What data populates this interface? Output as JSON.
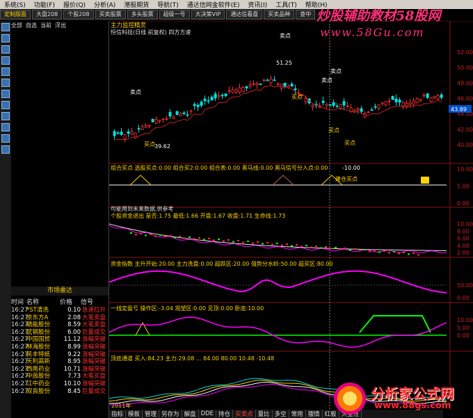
{
  "menu": [
    "系统(S)",
    "功能(F)",
    "报价(Q)",
    "分析(A)",
    "港股期货",
    "导航(T)",
    "通达信网金软件(E)",
    "资讯(I)",
    "工具(T)",
    "帮助(H)"
  ],
  "toolbar": [
    "定制版面",
    "大盘208",
    "个股208",
    "买卖股票",
    "多头股票",
    "超级一号",
    "大决策VIP",
    "通达信看盘",
    "买卖品种",
    "查中"
  ],
  "watermark": {
    "title": "炒股辅助教材58股网",
    "url": "www.58Gu.com"
  },
  "left_tabs": [
    "全部",
    "自选",
    "当前",
    "浮出"
  ],
  "radar": {
    "title": "市场雷达",
    "headers": [
      "时间",
      "名称",
      "价格",
      "信号"
    ],
    "rows": [
      [
        "16:27",
        "*ST清洗",
        "0.10",
        "急速拉升"
      ],
      [
        "16:27",
        "京东方A",
        "2.08",
        "大笔卖盘"
      ],
      [
        "16:27",
        "赣能股份",
        "8.59",
        "大笔卖盘"
      ],
      [
        "16:27",
        "武钢股份",
        "6.00",
        "巨量成交"
      ],
      [
        "16:27",
        "中国国贸",
        "11.12",
        "涨幅突破"
      ],
      [
        "16:27",
        "林海股份",
        "8.99",
        "涨幅突破"
      ],
      [
        "16:27",
        "民丰特纸",
        "9.22",
        "涨幅突破"
      ],
      [
        "16:27",
        "天利高新",
        "8.95",
        "涨幅突破"
      ],
      [
        "16:27",
        "西南药业",
        "10.71",
        "涨幅突破"
      ],
      [
        "16:27",
        "中茵股份",
        "7.73",
        "大笔买盘"
      ],
      [
        "16:27",
        "江中药业",
        "10.10",
        "涨幅突破"
      ],
      [
        "16:27",
        "双良股份",
        "8.45",
        "巨量成交"
      ]
    ]
  },
  "panels": {
    "kline": {
      "header": "主力监控精灵",
      "header2": "恒信科技(日线 前复权) 四方方速",
      "labels": {
        "sell1": "卖点",
        "sell2": "卖点",
        "sell3": "卖点",
        "sell4": "卖点",
        "buy1": "买点",
        "buy2": "买点",
        "buy3": "买点",
        "buy4": "买点",
        "hi": "51.25",
        "lo": "39.62"
      },
      "yticks": [
        "52.00",
        "50.00",
        "48.00",
        "46.00",
        "44.00",
        "42.00",
        "40.00"
      ],
      "current": "43.89"
    },
    "p2": {
      "header": "组合买点  选股买点:0.00  组合买2:0.00  组合表:0.00  黑马线:0.00  黑马信号分入点:0.00",
      "val": "-10.00",
      "tag": "建仓买点",
      "yticks": [
        "10.00",
        "5.00",
        "0.00"
      ]
    },
    "p3": {
      "note": "可能用到未来数据,供参考",
      "header": "个股资金进出  是否:1.75  最低:1.66  开盘:1.67  收盘:1.71  生命线:1.73",
      "yticks": [
        "10.00",
        "8.00",
        "6.00",
        "4.00",
        "2.00"
      ]
    },
    "p4": {
      "header": "资金指数  主升开始:20.00  主力洗盘:0.00  超跌区:20.00  强势分水岭:50.00  超买区:80.00",
      "yticks": [
        "50.00",
        "0.00"
      ]
    },
    "p5": {
      "header": "一线定盈亏  操作区:-3.04  观望区:0.00  见顶:0.00  卧底:10.00",
      "yticks": [
        "10.00",
        "5.00",
        "0.00"
      ]
    },
    "p6": {
      "header": "顶底通道  买入:84.23  主力:29.08  ...  84.00  80.00  10.48  -10.48",
      "date": "2011年"
    }
  },
  "bottom_tabs": [
    "指标",
    "模板",
    "管理",
    "另存为",
    "解盘",
    "DDE",
    "持仓",
    "买卖点",
    "量比",
    "多空",
    "常用",
    "摆情",
    "红板",
    "大全汪"
  ],
  "logo2": {
    "title": "分析家公式网",
    "url": "www.88gs.com"
  },
  "colors": {
    "up": "#ff3030",
    "down": "#00e0e0",
    "magenta": "#ff00ff",
    "green": "#00ff00",
    "yellow": "#ffd400"
  }
}
